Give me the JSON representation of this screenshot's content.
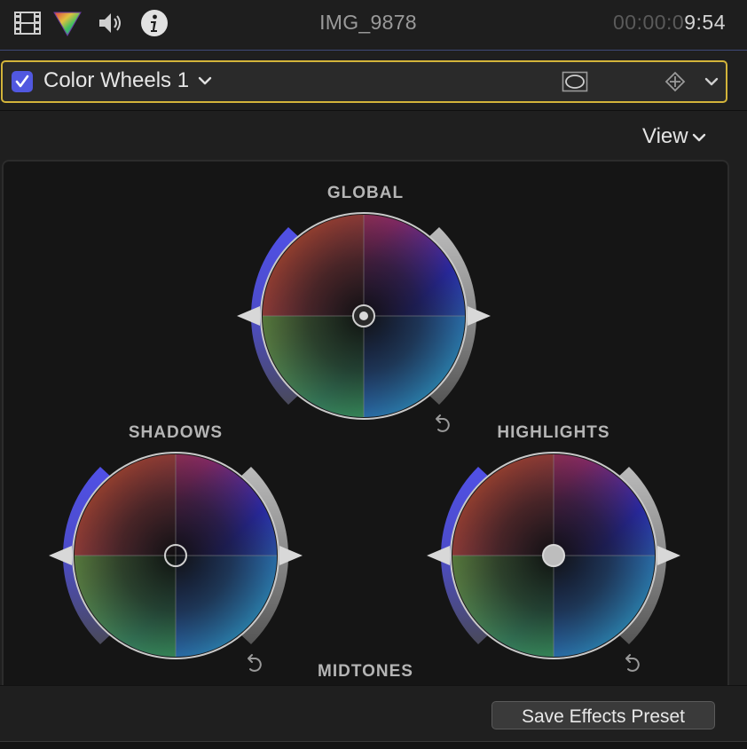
{
  "topbar": {
    "clip_name": "IMG_9878",
    "timecode_dim": "00:00:0",
    "timecode_bright": "9:54",
    "icons": [
      "film-strip-icon",
      "color-prism-icon",
      "speaker-icon",
      "info-icon"
    ]
  },
  "effect": {
    "name": "Color Wheels 1",
    "enabled": true,
    "icons": [
      "mask-icon",
      "keyframe-icon",
      "chevron-down-icon"
    ]
  },
  "view_menu": {
    "label": "View"
  },
  "wheels": {
    "global": {
      "label": "GLOBAL"
    },
    "shadows": {
      "label": "SHADOWS"
    },
    "highlights": {
      "label": "HIGHLIGHTS"
    },
    "midtones": {
      "label": "MIDTONES"
    }
  },
  "footer": {
    "save_label": "Save Effects Preset"
  },
  "colors": {
    "accent": "#5158e0",
    "selection_border": "#d3b43a"
  }
}
